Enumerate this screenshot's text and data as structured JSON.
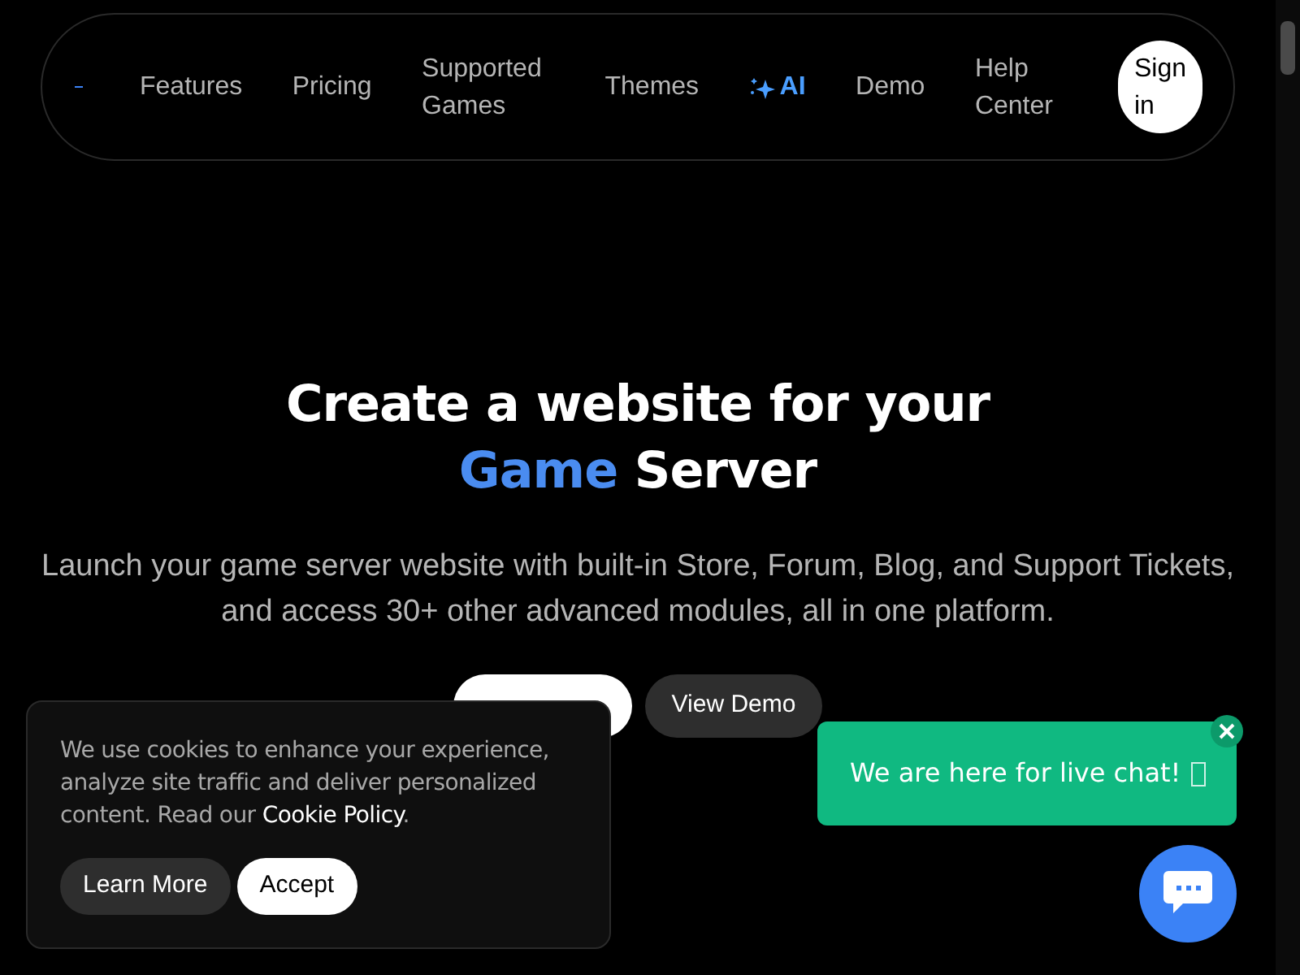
{
  "nav": {
    "items": [
      {
        "label": "Features",
        "kind": "link"
      },
      {
        "label": "Pricing",
        "kind": "link"
      },
      {
        "label": "Supported Games",
        "kind": "link"
      },
      {
        "label": "Themes",
        "kind": "link"
      },
      {
        "label": "AI",
        "kind": "ai"
      },
      {
        "label": "Demo",
        "kind": "link"
      },
      {
        "label": "Help Center",
        "kind": "link"
      }
    ],
    "sign_in": "Sign in"
  },
  "hero": {
    "title_line1": "Create a website for your",
    "title_highlight": "Game",
    "title_rest": "Server",
    "subtitle": "Launch your game server website with built-in Store, Forum, Blog, and Support Tickets, and access 30+ other advanced modules, all in one platform.",
    "buttons": [
      {
        "kind": "primary"
      },
      {
        "label": "View Demo",
        "kind": "secondary"
      }
    ]
  },
  "cookie_banner": {
    "text": "We use cookies to enhance your experience, analyze site traffic and deliver personalized content. Read our ",
    "link": "Cookie Policy",
    "after": ".",
    "buttons": [
      {
        "label": "Learn More",
        "kind": "secondary"
      },
      {
        "label": "Accept",
        "kind": "primary"
      }
    ]
  },
  "chat": {
    "message": "We are here for live chat!"
  }
}
